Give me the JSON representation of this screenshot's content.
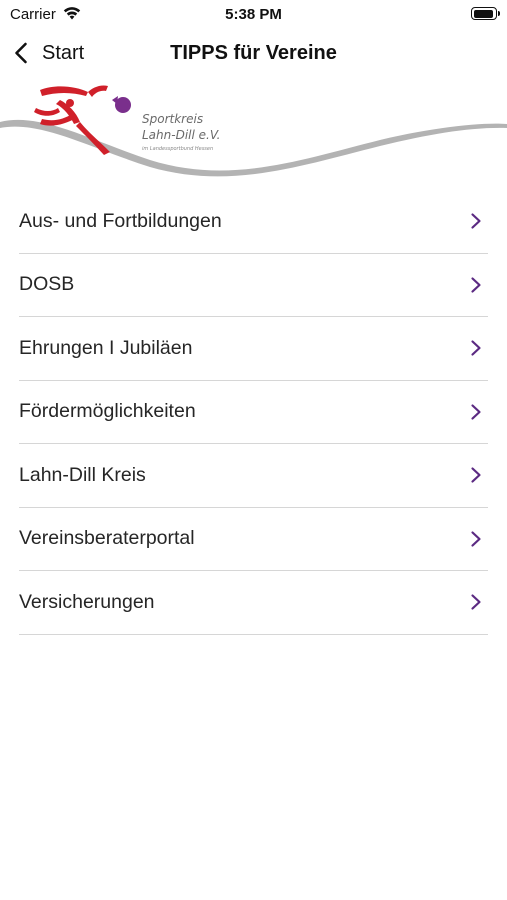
{
  "status_bar": {
    "carrier": "Carrier",
    "time": "5:38 PM"
  },
  "nav": {
    "back_label": "Start",
    "title": "TIPPS für Vereine"
  },
  "logo": {
    "line1": "Sportkreis",
    "line2": "Lahn-Dill e.V.",
    "line3": "im Landessportbund Hessen",
    "colors": {
      "red": "#d0202a",
      "purple": "#7a2f8c",
      "swoosh": "#b3b3b3"
    }
  },
  "menu": {
    "items": [
      {
        "label": "Aus- und Fortbildungen"
      },
      {
        "label": "DOSB"
      },
      {
        "label": "Ehrungen I Jubiläen"
      },
      {
        "label": "Fördermöglichkeiten"
      },
      {
        "label": "Lahn-Dill Kreis"
      },
      {
        "label": "Vereinsberaterportal"
      },
      {
        "label": "Versicherungen"
      }
    ],
    "chevron_color": "#5b2a82"
  }
}
